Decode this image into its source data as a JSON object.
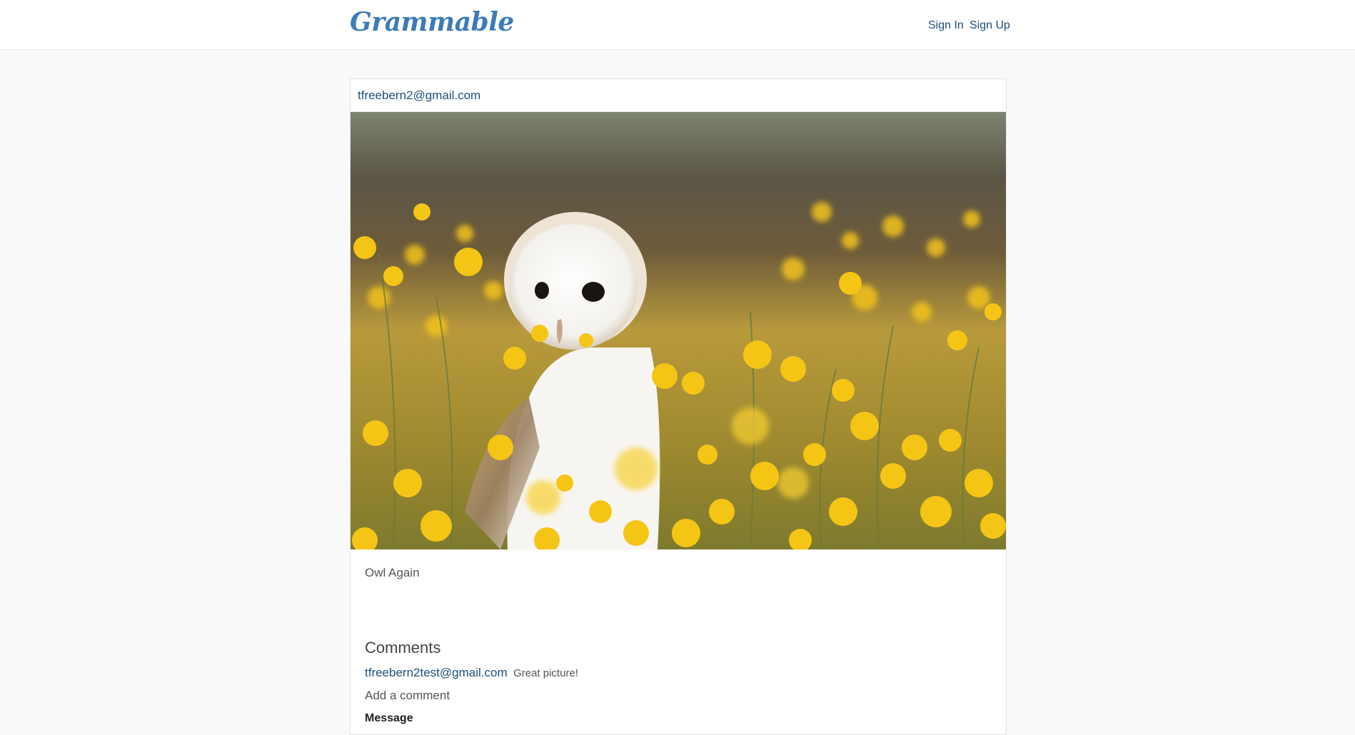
{
  "nav": {
    "brand": "Grammable",
    "sign_in": "Sign In",
    "sign_up": "Sign Up"
  },
  "post": {
    "author": "tfreebern2@gmail.com",
    "image_alt": "Barn owl in a field of yellow flowers",
    "caption": "Owl Again"
  },
  "comments": {
    "title": "Comments",
    "items": [
      {
        "user": "tfreebern2test@gmail.com",
        "text": "Great picture!"
      }
    ],
    "add_label": "Add a comment",
    "message_label": "Message"
  },
  "colors": {
    "brand": "#3d7bb5",
    "link": "#1f4e79",
    "background": "#f9f9f9"
  }
}
